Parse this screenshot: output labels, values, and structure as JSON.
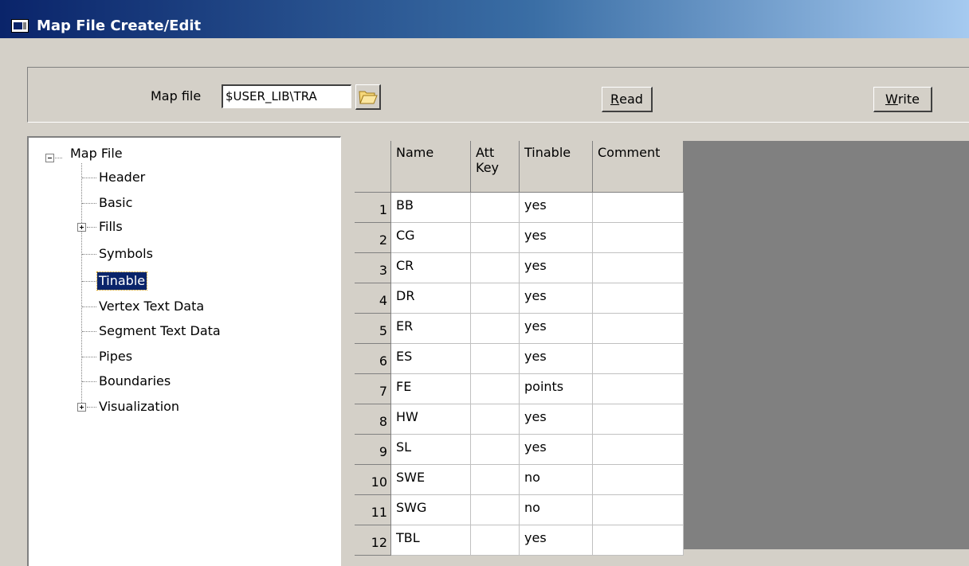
{
  "window": {
    "title": "Map File Create/Edit",
    "icon": "app-window-icon"
  },
  "toolbar": {
    "mapfile_label": "Map file",
    "mapfile_value": "$USER_LIB\\TRA",
    "folder_icon": "folder-open-icon",
    "read_label_accel": "R",
    "read_label_rest": "ead",
    "write_label_accel": "W",
    "write_label_rest": "rite"
  },
  "tree": {
    "root": "Map File",
    "items": [
      {
        "label": "Header",
        "expandable": false
      },
      {
        "label": "Basic",
        "expandable": false
      },
      {
        "label": "Fills",
        "expandable": true
      },
      {
        "label": "Symbols",
        "expandable": false
      },
      {
        "label": "Tinable",
        "expandable": false,
        "selected": true
      },
      {
        "label": "Vertex Text Data",
        "expandable": false
      },
      {
        "label": "Segment Text Data",
        "expandable": false
      },
      {
        "label": "Pipes",
        "expandable": false
      },
      {
        "label": "Boundaries",
        "expandable": false
      },
      {
        "label": "Visualization",
        "expandable": true
      }
    ]
  },
  "grid": {
    "columns": [
      {
        "label": "Name"
      },
      {
        "label": "Att\nKey"
      },
      {
        "label": "Tinable"
      },
      {
        "label": "Comment"
      }
    ],
    "rows": [
      {
        "num": "1",
        "name": "BB",
        "att_key": "",
        "tinable": "yes",
        "comment": ""
      },
      {
        "num": "2",
        "name": "CG",
        "att_key": "",
        "tinable": "yes",
        "comment": ""
      },
      {
        "num": "3",
        "name": "CR",
        "att_key": "",
        "tinable": "yes",
        "comment": ""
      },
      {
        "num": "4",
        "name": "DR",
        "att_key": "",
        "tinable": "yes",
        "comment": ""
      },
      {
        "num": "5",
        "name": "ER",
        "att_key": "",
        "tinable": "yes",
        "comment": ""
      },
      {
        "num": "6",
        "name": "ES",
        "att_key": "",
        "tinable": "yes",
        "comment": ""
      },
      {
        "num": "7",
        "name": "FE",
        "att_key": "",
        "tinable": "points",
        "comment": ""
      },
      {
        "num": "8",
        "name": "HW",
        "att_key": "",
        "tinable": "yes",
        "comment": ""
      },
      {
        "num": "9",
        "name": "SL",
        "att_key": "",
        "tinable": "yes",
        "comment": ""
      },
      {
        "num": "10",
        "name": "SWE",
        "att_key": "",
        "tinable": "no",
        "comment": ""
      },
      {
        "num": "11",
        "name": "SWG",
        "att_key": "",
        "tinable": "no",
        "comment": ""
      },
      {
        "num": "12",
        "name": "TBL",
        "att_key": "",
        "tinable": "yes",
        "comment": ""
      }
    ]
  }
}
